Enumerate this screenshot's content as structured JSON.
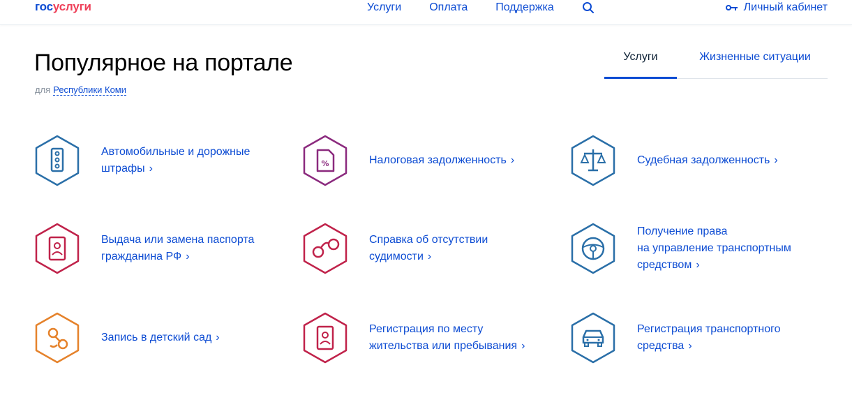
{
  "header": {
    "logo_part1": "гос",
    "logo_part2": "услуги",
    "nav": [
      "Услуги",
      "Оплата",
      "Поддержка"
    ],
    "search_icon": "search-icon",
    "cabinet_label": "Личный кабинет",
    "cabinet_icon": "key-icon"
  },
  "main": {
    "title": "Популярное на портале",
    "region_prefix": "для",
    "region_link": "Республики Коми",
    "tabs": [
      {
        "label": "Услуги",
        "active": true
      },
      {
        "label": "Жизненные ситуации",
        "active": false
      }
    ]
  },
  "services": [
    {
      "line1": "Автомобильные и дорожные",
      "line2": "штрафы",
      "icon": "traffic-light-icon",
      "color": "#1f6aa5"
    },
    {
      "line1": "Налоговая задолженность",
      "line2": "",
      "icon": "tax-document-icon",
      "color": "#8b2a7e"
    },
    {
      "line1": "Судебная задолженность",
      "line2": "",
      "icon": "scales-icon",
      "color": "#1f6aa5"
    },
    {
      "line1": "Выдача или замена паспорта",
      "line2": "гражданина РФ",
      "icon": "passport-icon",
      "color": "#c0224a"
    },
    {
      "line1": "Справка об отсутствии",
      "line2": "судимости",
      "icon": "handcuffs-icon",
      "color": "#c0224a"
    },
    {
      "line1": "Получение права",
      "line2": "на управление транспортным",
      "line3": "средством",
      "icon": "steering-wheel-icon",
      "color": "#1f6aa5"
    },
    {
      "line1": "Запись в детский сад",
      "line2": "",
      "icon": "pacifier-icon",
      "color": "#e5822b"
    },
    {
      "line1": "Регистрация по месту",
      "line2": "жительства или пребывания",
      "icon": "registration-document-icon",
      "color": "#c0224a"
    },
    {
      "line1": "Регистрация транспортного",
      "line2": "средства",
      "icon": "car-icon",
      "color": "#1f6aa5"
    }
  ],
  "chevron": "›"
}
